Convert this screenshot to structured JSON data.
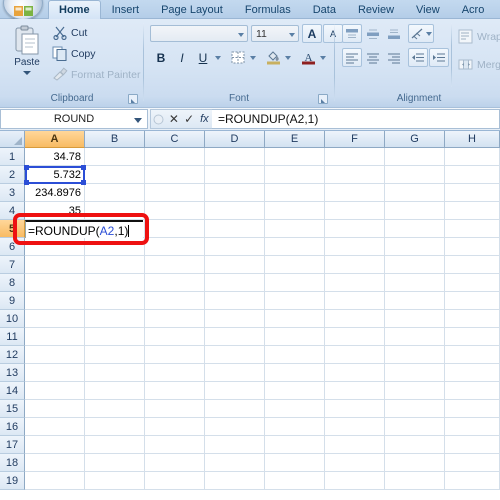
{
  "app": {
    "office_button": "office-orb",
    "tabs": [
      {
        "label": "Home",
        "active": true
      },
      {
        "label": "Insert",
        "active": false
      },
      {
        "label": "Page Layout",
        "active": false
      },
      {
        "label": "Formulas",
        "active": false
      },
      {
        "label": "Data",
        "active": false
      },
      {
        "label": "Review",
        "active": false
      },
      {
        "label": "View",
        "active": false
      },
      {
        "label": "Acro",
        "active": false
      }
    ]
  },
  "ribbon": {
    "clipboard": {
      "label": "Clipboard",
      "paste": "Paste",
      "cut": "Cut",
      "copy": "Copy",
      "format_painter": "Format Painter"
    },
    "font": {
      "label": "Font",
      "font_name": "",
      "font_size": "11",
      "grow_font": "A",
      "shrink_font": "A",
      "bold": "B",
      "italic": "I",
      "underline": "U"
    },
    "alignment": {
      "label": "Alignment",
      "wrap_text": "Wrap",
      "merge_center": "Merg"
    }
  },
  "formula_bar": {
    "name_box": "ROUND",
    "cancel": "✕",
    "enter": "✓",
    "insert_function": "fx",
    "formula": "=ROUNDUP(A2,1)"
  },
  "sheet": {
    "columns": [
      "A",
      "B",
      "C",
      "D",
      "E",
      "F",
      "G",
      "H"
    ],
    "selected_column": "A",
    "rows": [
      1,
      2,
      3,
      4,
      5,
      6,
      7,
      8,
      9,
      10,
      11,
      12,
      13,
      14,
      15,
      16,
      17,
      18,
      19
    ],
    "selected_row": 5,
    "cells": [
      {
        "ref": "A1",
        "col": 0,
        "row": 1,
        "value": "34.78"
      },
      {
        "ref": "A2",
        "col": 0,
        "row": 2,
        "value": "5.732"
      },
      {
        "ref": "A3",
        "col": 0,
        "row": 3,
        "value": "234.8976"
      },
      {
        "ref": "A4",
        "col": 0,
        "row": 4,
        "value": "35"
      }
    ],
    "reference_highlight": {
      "ref": "A2",
      "color": "#2b4ed6"
    },
    "editing_cell": {
      "ref": "A5",
      "prefix": "=ROUNDUP(",
      "reference": "A2",
      "suffix": ",1)"
    },
    "annotation": {
      "shape": "rectangle",
      "color": "#ee1111",
      "around": "A5"
    }
  }
}
